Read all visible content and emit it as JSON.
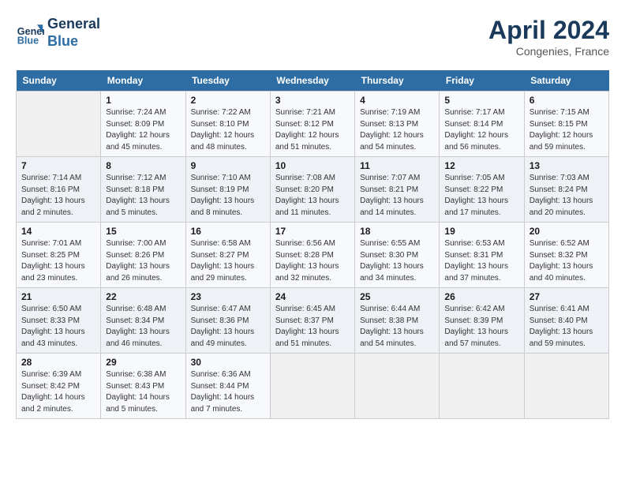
{
  "header": {
    "logo_line1": "General",
    "logo_line2": "Blue",
    "month": "April 2024",
    "location": "Congenies, France"
  },
  "weekdays": [
    "Sunday",
    "Monday",
    "Tuesday",
    "Wednesday",
    "Thursday",
    "Friday",
    "Saturday"
  ],
  "weeks": [
    [
      {
        "day": "",
        "info": ""
      },
      {
        "day": "1",
        "info": "Sunrise: 7:24 AM\nSunset: 8:09 PM\nDaylight: 12 hours\nand 45 minutes."
      },
      {
        "day": "2",
        "info": "Sunrise: 7:22 AM\nSunset: 8:10 PM\nDaylight: 12 hours\nand 48 minutes."
      },
      {
        "day": "3",
        "info": "Sunrise: 7:21 AM\nSunset: 8:12 PM\nDaylight: 12 hours\nand 51 minutes."
      },
      {
        "day": "4",
        "info": "Sunrise: 7:19 AM\nSunset: 8:13 PM\nDaylight: 12 hours\nand 54 minutes."
      },
      {
        "day": "5",
        "info": "Sunrise: 7:17 AM\nSunset: 8:14 PM\nDaylight: 12 hours\nand 56 minutes."
      },
      {
        "day": "6",
        "info": "Sunrise: 7:15 AM\nSunset: 8:15 PM\nDaylight: 12 hours\nand 59 minutes."
      }
    ],
    [
      {
        "day": "7",
        "info": "Sunrise: 7:14 AM\nSunset: 8:16 PM\nDaylight: 13 hours\nand 2 minutes."
      },
      {
        "day": "8",
        "info": "Sunrise: 7:12 AM\nSunset: 8:18 PM\nDaylight: 13 hours\nand 5 minutes."
      },
      {
        "day": "9",
        "info": "Sunrise: 7:10 AM\nSunset: 8:19 PM\nDaylight: 13 hours\nand 8 minutes."
      },
      {
        "day": "10",
        "info": "Sunrise: 7:08 AM\nSunset: 8:20 PM\nDaylight: 13 hours\nand 11 minutes."
      },
      {
        "day": "11",
        "info": "Sunrise: 7:07 AM\nSunset: 8:21 PM\nDaylight: 13 hours\nand 14 minutes."
      },
      {
        "day": "12",
        "info": "Sunrise: 7:05 AM\nSunset: 8:22 PM\nDaylight: 13 hours\nand 17 minutes."
      },
      {
        "day": "13",
        "info": "Sunrise: 7:03 AM\nSunset: 8:24 PM\nDaylight: 13 hours\nand 20 minutes."
      }
    ],
    [
      {
        "day": "14",
        "info": "Sunrise: 7:01 AM\nSunset: 8:25 PM\nDaylight: 13 hours\nand 23 minutes."
      },
      {
        "day": "15",
        "info": "Sunrise: 7:00 AM\nSunset: 8:26 PM\nDaylight: 13 hours\nand 26 minutes."
      },
      {
        "day": "16",
        "info": "Sunrise: 6:58 AM\nSunset: 8:27 PM\nDaylight: 13 hours\nand 29 minutes."
      },
      {
        "day": "17",
        "info": "Sunrise: 6:56 AM\nSunset: 8:28 PM\nDaylight: 13 hours\nand 32 minutes."
      },
      {
        "day": "18",
        "info": "Sunrise: 6:55 AM\nSunset: 8:30 PM\nDaylight: 13 hours\nand 34 minutes."
      },
      {
        "day": "19",
        "info": "Sunrise: 6:53 AM\nSunset: 8:31 PM\nDaylight: 13 hours\nand 37 minutes."
      },
      {
        "day": "20",
        "info": "Sunrise: 6:52 AM\nSunset: 8:32 PM\nDaylight: 13 hours\nand 40 minutes."
      }
    ],
    [
      {
        "day": "21",
        "info": "Sunrise: 6:50 AM\nSunset: 8:33 PM\nDaylight: 13 hours\nand 43 minutes."
      },
      {
        "day": "22",
        "info": "Sunrise: 6:48 AM\nSunset: 8:34 PM\nDaylight: 13 hours\nand 46 minutes."
      },
      {
        "day": "23",
        "info": "Sunrise: 6:47 AM\nSunset: 8:36 PM\nDaylight: 13 hours\nand 49 minutes."
      },
      {
        "day": "24",
        "info": "Sunrise: 6:45 AM\nSunset: 8:37 PM\nDaylight: 13 hours\nand 51 minutes."
      },
      {
        "day": "25",
        "info": "Sunrise: 6:44 AM\nSunset: 8:38 PM\nDaylight: 13 hours\nand 54 minutes."
      },
      {
        "day": "26",
        "info": "Sunrise: 6:42 AM\nSunset: 8:39 PM\nDaylight: 13 hours\nand 57 minutes."
      },
      {
        "day": "27",
        "info": "Sunrise: 6:41 AM\nSunset: 8:40 PM\nDaylight: 13 hours\nand 59 minutes."
      }
    ],
    [
      {
        "day": "28",
        "info": "Sunrise: 6:39 AM\nSunset: 8:42 PM\nDaylight: 14 hours\nand 2 minutes."
      },
      {
        "day": "29",
        "info": "Sunrise: 6:38 AM\nSunset: 8:43 PM\nDaylight: 14 hours\nand 5 minutes."
      },
      {
        "day": "30",
        "info": "Sunrise: 6:36 AM\nSunset: 8:44 PM\nDaylight: 14 hours\nand 7 minutes."
      },
      {
        "day": "",
        "info": ""
      },
      {
        "day": "",
        "info": ""
      },
      {
        "day": "",
        "info": ""
      },
      {
        "day": "",
        "info": ""
      }
    ]
  ]
}
